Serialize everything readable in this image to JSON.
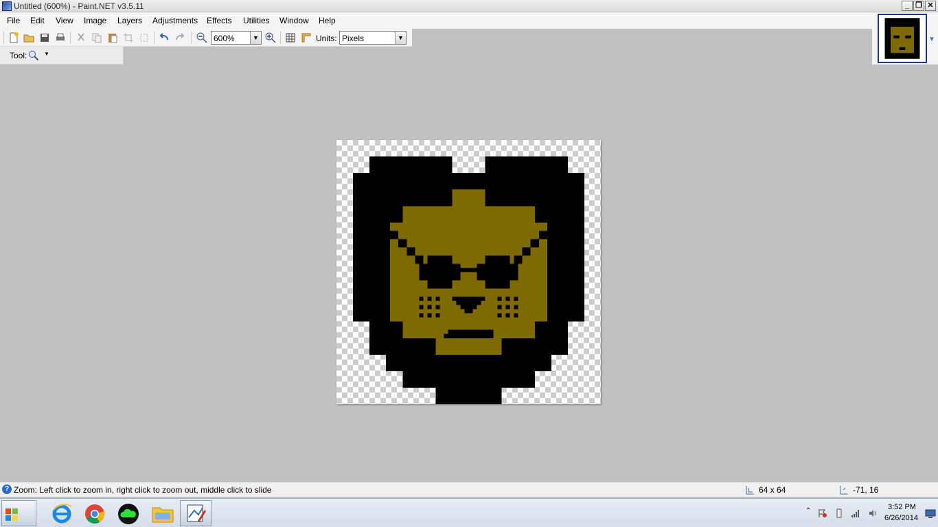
{
  "window": {
    "title": "Untitled (600%) - Paint.NET v3.5.11",
    "controls": {
      "minimize": "_",
      "restore": "❐",
      "close": "✕"
    }
  },
  "menu": [
    "File",
    "Edit",
    "View",
    "Image",
    "Layers",
    "Adjustments",
    "Effects",
    "Utilities",
    "Window",
    "Help"
  ],
  "toolbar": {
    "zoom_value": "600%",
    "units_label": "Units:",
    "units_value": "Pixels"
  },
  "tool": {
    "label": "Tool:",
    "current_icon": "magnifier-icon"
  },
  "status": {
    "message": "Zoom: Left click to zoom in, right click to zoom out, middle click to slide",
    "image_size": "64 x 64",
    "cursor_position": "-71, 16"
  },
  "taskbar": {
    "apps": [
      "start-orb",
      "internet-explorer",
      "chrome",
      "cloud-app",
      "file-explorer",
      "paint-net"
    ],
    "time": "3:52 PM",
    "date": "6/26/2014"
  },
  "colors": {
    "skin": "#7f6a00",
    "ink": "#000000"
  }
}
